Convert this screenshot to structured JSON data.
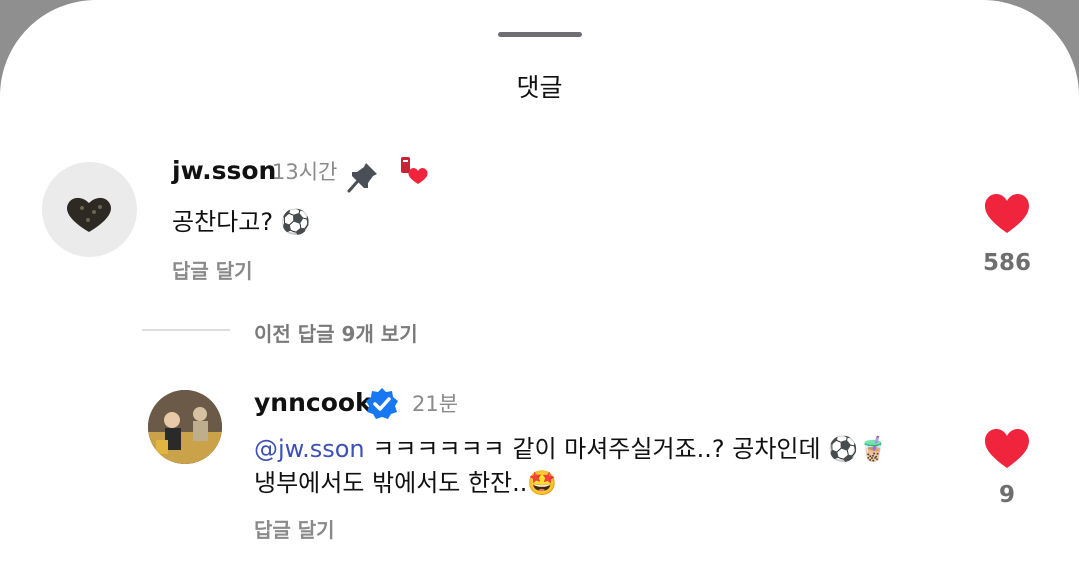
{
  "sheet": {
    "title": "댓글"
  },
  "comment": {
    "username": "jw.sson",
    "time": "13시간",
    "text": "공찬다고? ⚽",
    "reply_label": "답글 달기",
    "like_count": "586"
  },
  "thread": {
    "view_previous": "이전 답글 9개 보기"
  },
  "reply": {
    "username": "ynncook",
    "time": "21분",
    "mention": "@jw.sson",
    "line1": " ㅋㅋㅋㅋㅋㅋ 같이 마셔주실거죠..? 공차인데 ⚽🧋",
    "line2": "냉부에서도 밖에서도 한잔..🤩",
    "reply_label": "답글 달기",
    "like_count": "9"
  },
  "icons": {
    "pin": "pin-icon",
    "sticker": "heart-sticker-icon",
    "verified": "verified-badge-icon",
    "like": "heart-icon"
  },
  "colors": {
    "like": "#f0243c",
    "mention": "#3f51b5",
    "verified": "#1877f2"
  }
}
